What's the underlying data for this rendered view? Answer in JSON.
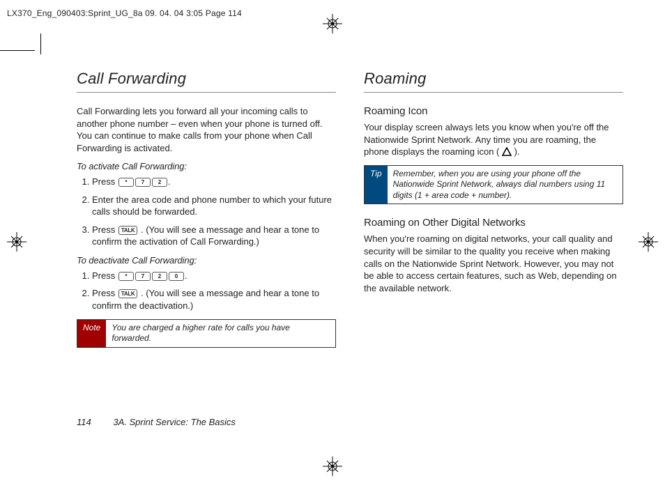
{
  "meta": {
    "header": "LX370_Eng_090403:Sprint_UG_8a  09. 04. 04     3:05  Page 114"
  },
  "left": {
    "title": "Call Forwarding",
    "intro": "Call Forwarding lets you forward all your incoming calls to another phone number – even when your phone is turned off. You can continue to make calls from your phone when Call Forwarding is activated.",
    "activate_label": "To activate Call Forwarding:",
    "activate": {
      "s1a": "Press ",
      "s1_keys": [
        "*",
        "7",
        "2"
      ],
      "s1b": ".",
      "s2": "Enter the area code and phone number to which your future calls should be forwarded.",
      "s3a": "Press ",
      "s3_key": "TALK",
      "s3b": " . (You will see a message and hear a tone to confirm the activation of Call Forwarding.)"
    },
    "deactivate_label": "To deactivate Call Forwarding:",
    "deactivate": {
      "s1a": "Press ",
      "s1_keys": [
        "*",
        "7",
        "2",
        "0"
      ],
      "s1b": ".",
      "s2a": "Press ",
      "s2_key": "TALK",
      "s2b": " . (You will see a message and hear a tone to confirm the deactivation.)"
    },
    "note_label": "Note",
    "note_body": "You are charged a higher rate for calls you have forwarded."
  },
  "right": {
    "title": "Roaming",
    "icon_heading": "Roaming Icon",
    "icon_para_a": "Your display screen always lets you know when you're off the Nationwide Sprint Network. Any time you are roaming, the phone displays the roaming icon ( ",
    "icon_para_b": " ).",
    "tip_label": "Tip",
    "tip_body": "Remember, when you are using your phone off the Nationwide Sprint Network, always dial numbers using 11 digits (1 + area code + number).",
    "other_heading": "Roaming on Other Digital Networks",
    "other_para": "When you're roaming on digital networks, your call quality and security will be similar to the quality you receive when making calls on the Nationwide Sprint Network. However, you may not be able to access certain features, such as Web, depending on the available network."
  },
  "footer": {
    "page": "114",
    "section": "3A. Sprint Service: The Basics"
  }
}
